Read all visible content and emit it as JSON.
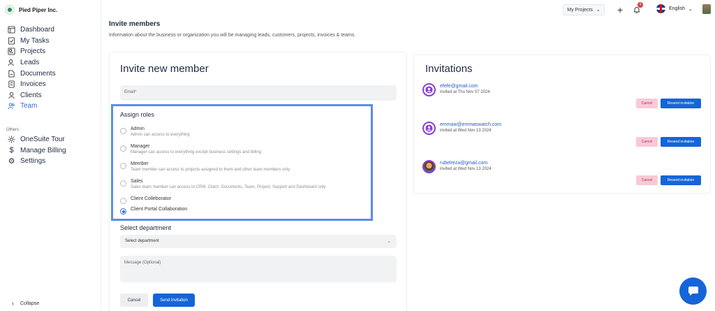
{
  "brand": {
    "name": "Pied Piper Inc."
  },
  "sidebar": {
    "items": [
      {
        "label": "Dashboard",
        "icon": "dashboard-icon"
      },
      {
        "label": "My Tasks",
        "icon": "checklist-icon"
      },
      {
        "label": "Projects",
        "icon": "projects-icon"
      },
      {
        "label": "Leads",
        "icon": "leads-icon"
      },
      {
        "label": "Documents",
        "icon": "document-icon"
      },
      {
        "label": "Invoices",
        "icon": "invoice-icon"
      },
      {
        "label": "Clients",
        "icon": "clients-icon"
      },
      {
        "label": "Team",
        "icon": "team-icon",
        "active": true
      }
    ],
    "others_label": "Others",
    "others": [
      {
        "label": "OneSuite Tour",
        "icon": "sun-icon"
      },
      {
        "label": "Manage Billing",
        "icon": "dollar-icon"
      },
      {
        "label": "Settings",
        "icon": "gear-icon"
      }
    ],
    "collapse_label": "Collapse"
  },
  "topbar": {
    "projects_label": "My Projects",
    "notification_count": "4",
    "language": "English"
  },
  "header": {
    "title": "Invite members",
    "description": "Information about the business or organization you will be managing leads, customers, projects, invoices & teams."
  },
  "invite_form": {
    "title": "Invite new member",
    "email_placeholder": "Email",
    "roles_title": "Assign roles",
    "roles": [
      {
        "name": "Admin",
        "desc": "Admin can access to everything",
        "checked": false
      },
      {
        "name": "Manager",
        "desc": "Manager can access to everything except business settings and billing",
        "checked": false
      },
      {
        "name": "Member",
        "desc": "Team member can access to projects assigned to them and other team members only",
        "checked": false
      },
      {
        "name": "Sales",
        "desc": "Sales team member can access to CRM, Client, Documents, Team, Project, Support and Dashboard only",
        "checked": false
      },
      {
        "name": "Client Colleborator",
        "desc": "",
        "checked": false
      },
      {
        "name": "Client Portal Collaboration",
        "desc": "",
        "checked": true
      }
    ],
    "department_label": "Select department",
    "department_placeholder": "Select department",
    "message_placeholder": "Message (Optional)",
    "cancel_label": "Cancel",
    "send_label": "Send Invitation"
  },
  "invitations": {
    "title": "Invitations",
    "items": [
      {
        "email": "efefe@gmail.com",
        "date": "invited at Thu Nov 07 2024",
        "avatar": "user-icon"
      },
      {
        "email": "emmaw@emmaswatch.com",
        "date": "invited at Wed Nov 13 2024",
        "avatar": "user-icon"
      },
      {
        "email": "rubelreza@gmail.com",
        "date": "invited at Wed Nov 13 2024",
        "avatar": "photo"
      }
    ],
    "cancel_label": "Cancel",
    "resend_label": "Resend invitation"
  },
  "colors": {
    "primary": "#1565d8",
    "highlight": "#5b8dea",
    "active_nav": "#2f6fd6",
    "danger_bg": "#f9c9d6"
  }
}
